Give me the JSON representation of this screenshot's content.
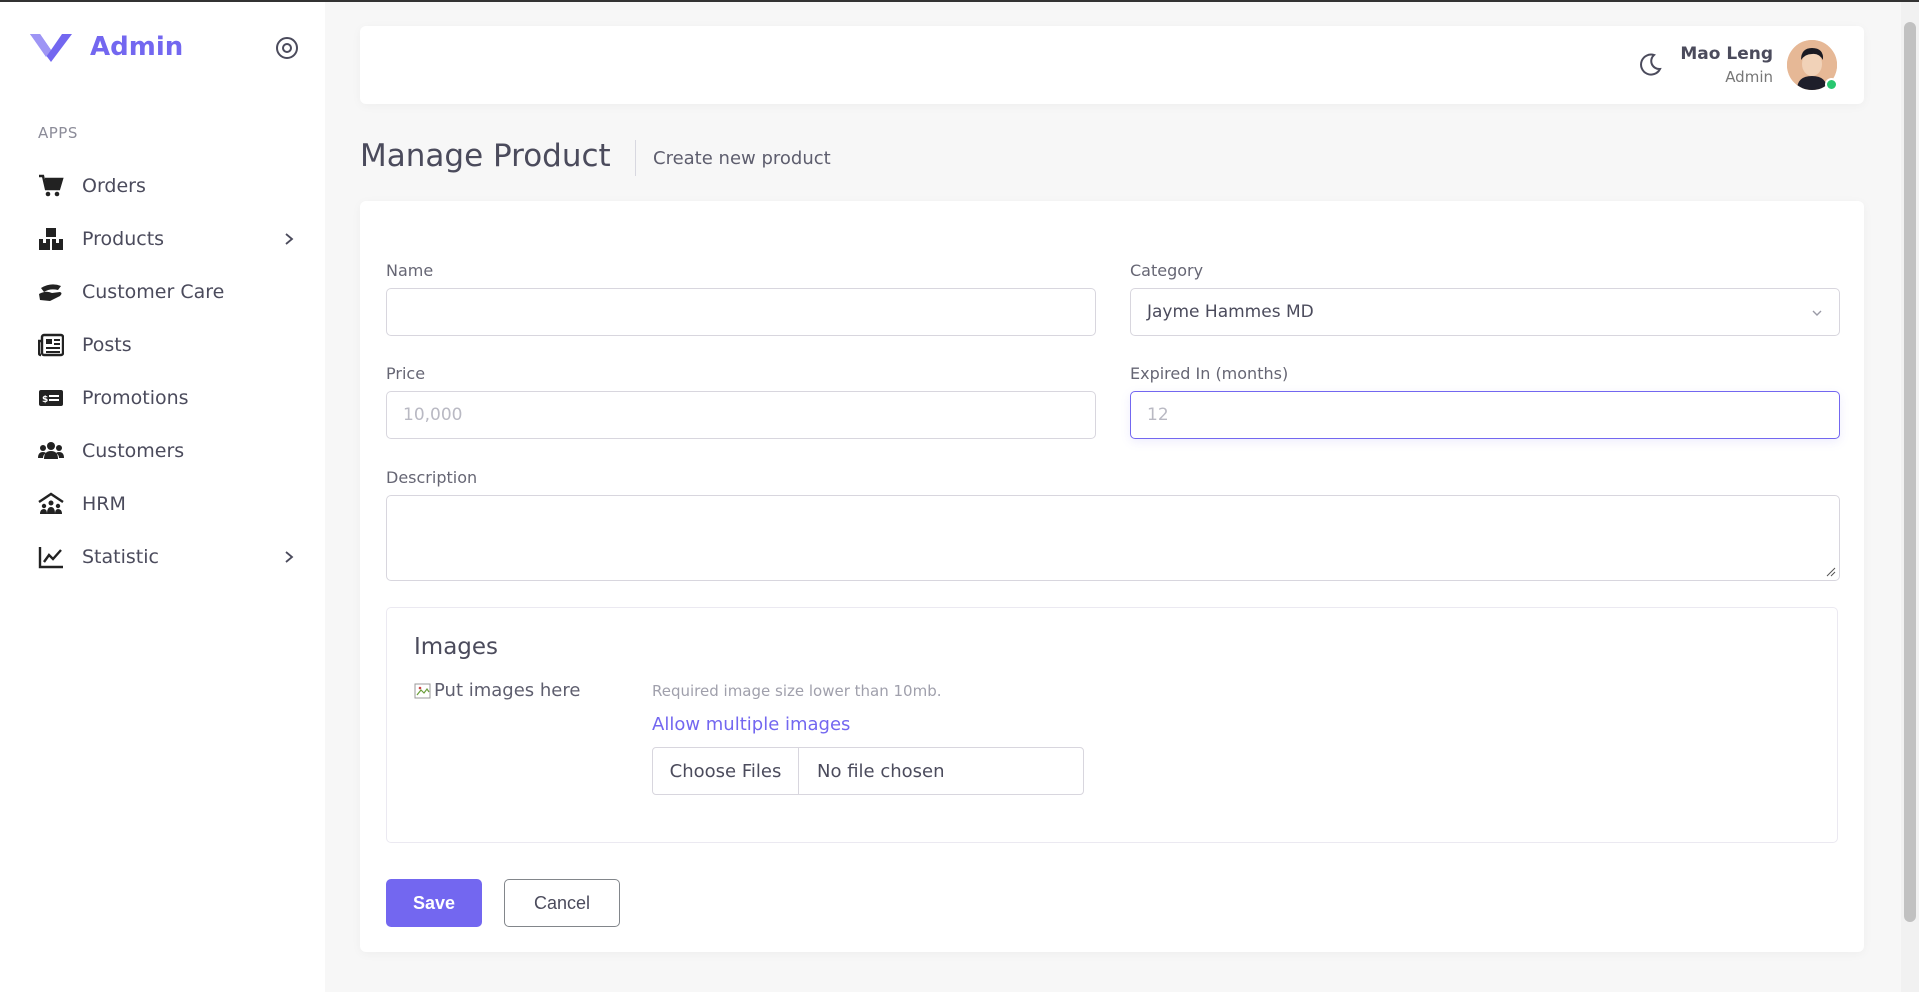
{
  "sidebar": {
    "brand_name": "Admin",
    "section_title": "APPS",
    "items": [
      {
        "label": "Orders",
        "icon": "cart-icon",
        "has_submenu": false
      },
      {
        "label": "Products",
        "icon": "boxes-icon",
        "has_submenu": true
      },
      {
        "label": "Customer Care",
        "icon": "hand-holding-icon",
        "has_submenu": false
      },
      {
        "label": "Posts",
        "icon": "newspaper-icon",
        "has_submenu": false
      },
      {
        "label": "Promotions",
        "icon": "money-bill-icon",
        "has_submenu": false
      },
      {
        "label": "Customers",
        "icon": "users-icon",
        "has_submenu": false
      },
      {
        "label": "HRM",
        "icon": "people-roof-icon",
        "has_submenu": false
      },
      {
        "label": "Statistic",
        "icon": "chart-line-icon",
        "has_submenu": true
      }
    ]
  },
  "header": {
    "user_name": "Mao Leng",
    "user_role": "Admin"
  },
  "page": {
    "title": "Manage Product",
    "subtitle": "Create new product"
  },
  "form": {
    "name": {
      "label": "Name",
      "value": "",
      "placeholder": ""
    },
    "category": {
      "label": "Category",
      "selected": "Jayme Hammes MD"
    },
    "price": {
      "label": "Price",
      "value": "",
      "placeholder": "10,000"
    },
    "expired": {
      "label": "Expired In (months)",
      "value": "",
      "placeholder": "12"
    },
    "description": {
      "label": "Description",
      "value": ""
    },
    "images": {
      "title": "Images",
      "alt_text": "Put images here",
      "requirement": "Required image size lower than 10mb.",
      "multi_link": "Allow multiple images",
      "choose_button": "Choose Files",
      "file_status": "No file chosen"
    },
    "save_label": "Save",
    "cancel_label": "Cancel"
  },
  "colors": {
    "accent": "#7367f0",
    "online": "#28c76f"
  }
}
